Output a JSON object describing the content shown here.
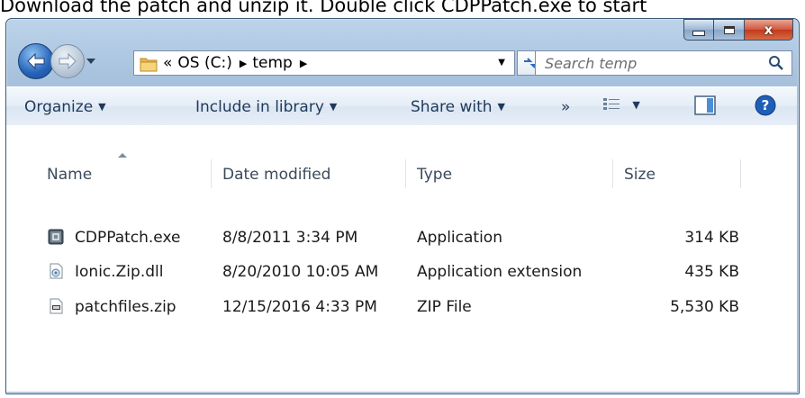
{
  "caption": "Download the patch and unzip it.  Double click CDPPatch.exe to start",
  "window": {
    "controls": {
      "minimize": "minimize",
      "maximize": "maximize",
      "close": "x"
    }
  },
  "breadcrumb": {
    "overflow": "«",
    "items": [
      "OS (C:)",
      "temp"
    ]
  },
  "search": {
    "placeholder": "Search temp"
  },
  "toolbar": {
    "organize": "Organize",
    "include": "Include in library",
    "share": "Share with",
    "more": "»"
  },
  "columns": {
    "name": "Name",
    "date": "Date modified",
    "type": "Type",
    "size": "Size"
  },
  "files": [
    {
      "name": "CDPPatch.exe",
      "date": "8/8/2011 3:34 PM",
      "type": "Application",
      "size": "314 KB",
      "icon": "application-icon"
    },
    {
      "name": "Ionic.Zip.dll",
      "date": "8/20/2010 10:05 AM",
      "type": "Application extension",
      "size": "435 KB",
      "icon": "dll-icon"
    },
    {
      "name": "patchfiles.zip",
      "date": "12/15/2016 4:33 PM",
      "type": "ZIP File",
      "size": "5,530 KB",
      "icon": "zip-icon"
    }
  ],
  "colors": {
    "accent": "#1e395b",
    "frame": "#a9c3de",
    "close": "#c13a1d"
  }
}
